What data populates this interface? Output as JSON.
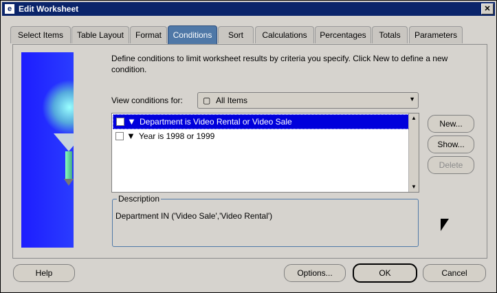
{
  "window": {
    "title": "Edit Worksheet",
    "close": "✕"
  },
  "tabs": [
    {
      "label": "Select Items"
    },
    {
      "label": "Table Layout"
    },
    {
      "label": "Format"
    },
    {
      "label": "Conditions"
    },
    {
      "label": "Sort"
    },
    {
      "label": "Calculations"
    },
    {
      "label": "Percentages"
    },
    {
      "label": "Totals"
    },
    {
      "label": "Parameters"
    }
  ],
  "conditions": {
    "intro": "Define conditions to limit worksheet results by criteria you specify. Click New to define a new condition.",
    "view_label": "View conditions for:",
    "view_value": "All Items",
    "items": [
      {
        "text": "Department is Video Rental or Video Sale",
        "selected": true
      },
      {
        "text": "Year is 1998 or 1999",
        "selected": false
      }
    ],
    "buttons": {
      "new": "New...",
      "show": "Show...",
      "delete": "Delete"
    },
    "description_legend": "Description",
    "description_text": "Department IN ('Video Sale','Video Rental')"
  },
  "footer": {
    "help": "Help",
    "options": "Options...",
    "ok": "OK",
    "cancel": "Cancel"
  }
}
